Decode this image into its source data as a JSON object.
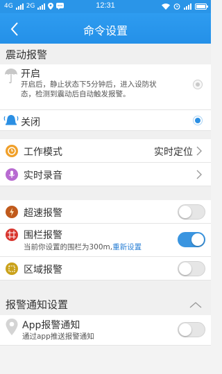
{
  "status_bar": {
    "network_1": "4G",
    "network_2": "2G",
    "time": "12:31"
  },
  "header": {
    "title": "命令设置"
  },
  "vibration_section": {
    "title": "震动报警",
    "option_on": {
      "label": "开启",
      "description": "开启后，静止状态下5分钟后，进入设防状态，检测到震动后自动触发报警。",
      "selected": false
    },
    "option_off": {
      "label": "关闭",
      "selected": true
    }
  },
  "work_mode": {
    "label": "工作模式",
    "value": "实时定位"
  },
  "voice_record": {
    "label": "实时录音"
  },
  "alarms": {
    "overspeed": {
      "label": "超速报警",
      "enabled": false
    },
    "fence": {
      "label": "围栏报警",
      "enabled": true,
      "description_prefix": "当前你设置的围栏为300m,",
      "reset_link": "重新设置"
    },
    "region": {
      "label": "区域报警",
      "enabled": false
    }
  },
  "notify_section": {
    "title": "报警通知设置",
    "app_notify": {
      "label": "App报警通知",
      "description": "通过app推送报警通知",
      "enabled": false
    }
  },
  "colors": {
    "primary": "#2a95e8",
    "overspeed_icon": "#c05a1c",
    "fence_icon": "#d8362f",
    "region_icon": "#caa21b",
    "work_mode_icon": "#f0a02a",
    "voice_icon": "#b86bd1"
  }
}
